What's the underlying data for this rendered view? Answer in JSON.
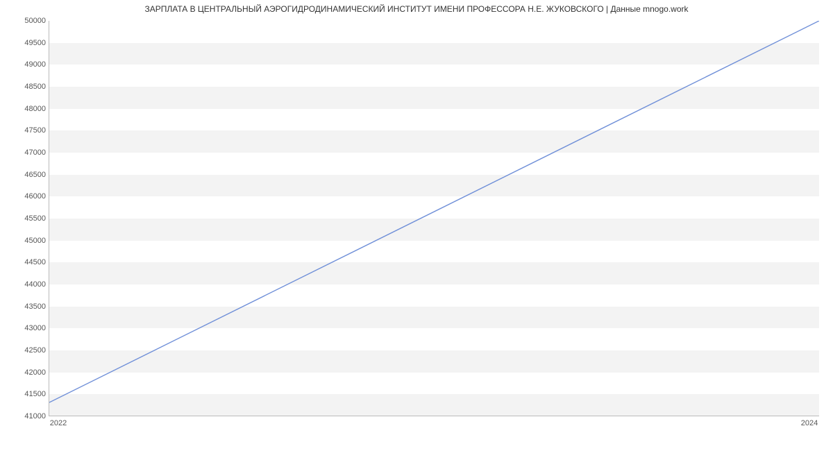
{
  "chart_data": {
    "type": "line",
    "title": "ЗАРПЛАТА В  ЦЕНТРАЛЬНЫЙ АЭРОГИДРОДИНАМИЧЕСКИЙ ИНСТИТУТ ИМЕНИ ПРОФЕССОРА Н.Е. ЖУКОВСКОГО | Данные mnogo.work",
    "xlabel": "",
    "ylabel": "",
    "x": [
      2022,
      2024
    ],
    "series": [
      {
        "name": "salary",
        "values": [
          41300,
          50000
        ],
        "color": "#6f8fd8"
      }
    ],
    "xlim": [
      2022,
      2024
    ],
    "ylim": [
      41000,
      50000
    ],
    "y_ticks": [
      41000,
      41500,
      42000,
      42500,
      43000,
      43500,
      44000,
      44500,
      45000,
      45500,
      46000,
      46500,
      47000,
      47500,
      48000,
      48500,
      49000,
      49500,
      50000
    ],
    "x_ticks": [
      2022,
      2024
    ],
    "grid": true
  }
}
